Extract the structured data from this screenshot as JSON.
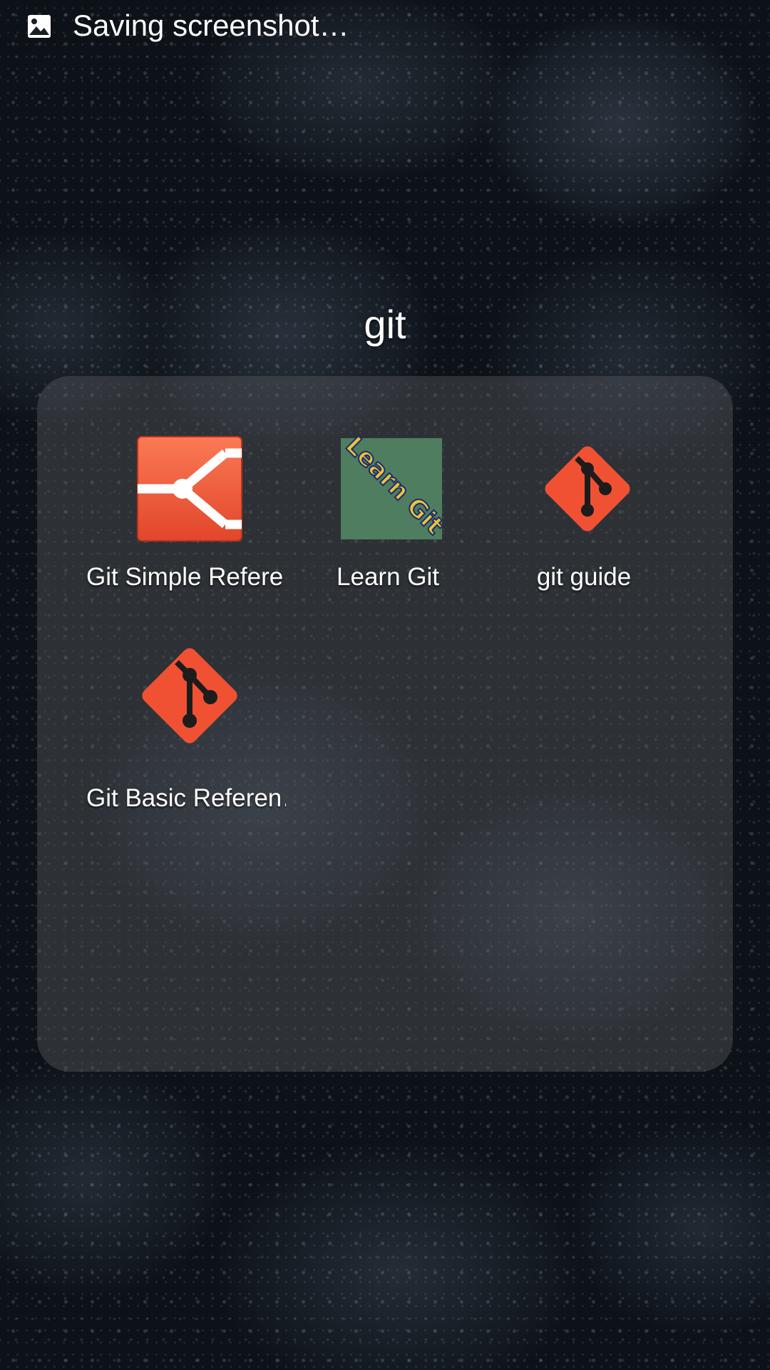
{
  "status_bar": {
    "notification_icon": "image-icon",
    "text": "Saving screenshot…"
  },
  "folder": {
    "title": "git",
    "apps": [
      {
        "label": "Git Simple Refere…",
        "icon": "git-simple-reference-icon"
      },
      {
        "label": "Learn Git",
        "icon": "learn-git-icon",
        "icon_text": "Learn Git"
      },
      {
        "label": "git guide",
        "icon": "git-logo-icon"
      },
      {
        "label": "Git Basic Referen…",
        "icon": "git-logo-icon"
      }
    ]
  },
  "colors": {
    "git_orange": "#F05133",
    "learn_git_green": "#4E7D5F",
    "label_text": "#FFFFFF"
  }
}
